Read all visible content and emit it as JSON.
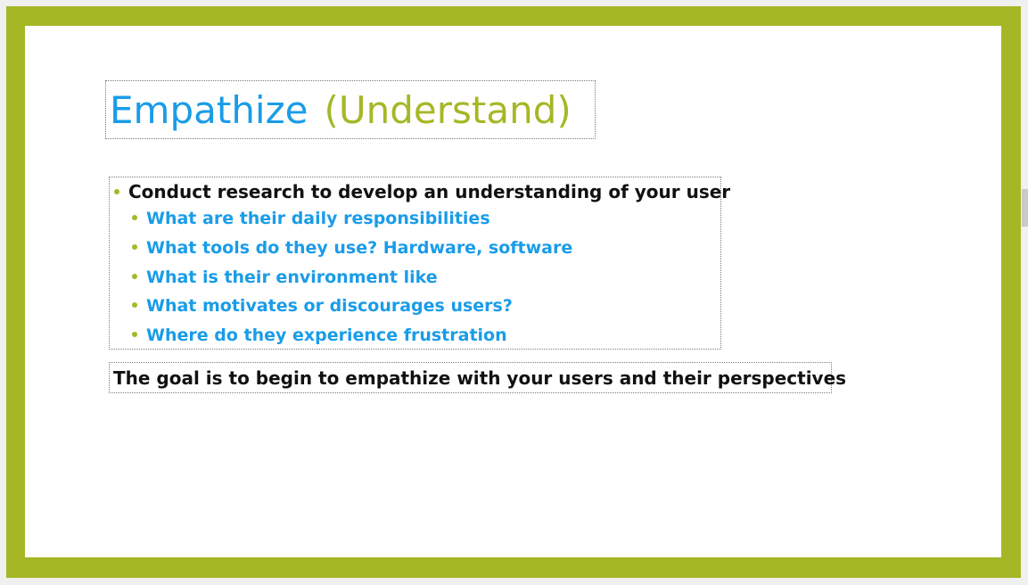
{
  "slide": {
    "title_main": "Empathize",
    "title_sub": "(Understand)",
    "bullet_main": "Conduct research to develop an understanding of your user",
    "sub_bullets": [
      "What are their daily responsibilities",
      "What tools do they use? Hardware, software",
      "What is their environment like",
      "What motivates or discourages users?",
      "Where do they experience frustration"
    ],
    "goal": "The goal is to begin to empathize with your users and their perspectives"
  },
  "colors": {
    "frame": "#a6b726",
    "title_blue": "#1a9ce8",
    "subtitle_green": "#a6b726",
    "text_dark": "#111111"
  }
}
